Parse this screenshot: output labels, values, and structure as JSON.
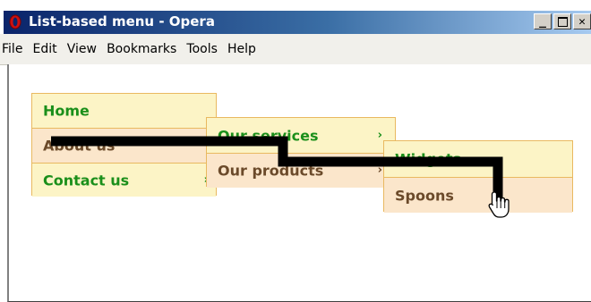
{
  "window": {
    "title": "List-based menu - Opera"
  },
  "menubar": {
    "items": [
      "File",
      "Edit",
      "View",
      "Bookmarks",
      "Tools",
      "Help"
    ]
  },
  "menu": {
    "level1": [
      {
        "label": "Home",
        "arrow": ""
      },
      {
        "label": "About us",
        "arrow": ""
      },
      {
        "label": "Contact us",
        "arrow": "›"
      }
    ],
    "level2": [
      {
        "label": "Our services",
        "arrow": "›"
      },
      {
        "label": "Our products",
        "arrow": "›"
      }
    ],
    "level3": [
      {
        "label": "Widgets",
        "arrow": ""
      },
      {
        "label": "Spoons",
        "arrow": ""
      }
    ]
  },
  "colors": {
    "item_green_bg": "#fcf4c6",
    "item_green_text": "#1a8f1a",
    "item_brown_bg": "#fbe6cb",
    "item_brown_text": "#6b4a2a",
    "border": "#e9b960",
    "mouse_path": "#000000"
  },
  "icons": {
    "app": "opera-logo-icon",
    "cursor": "hand-pointer-icon"
  }
}
